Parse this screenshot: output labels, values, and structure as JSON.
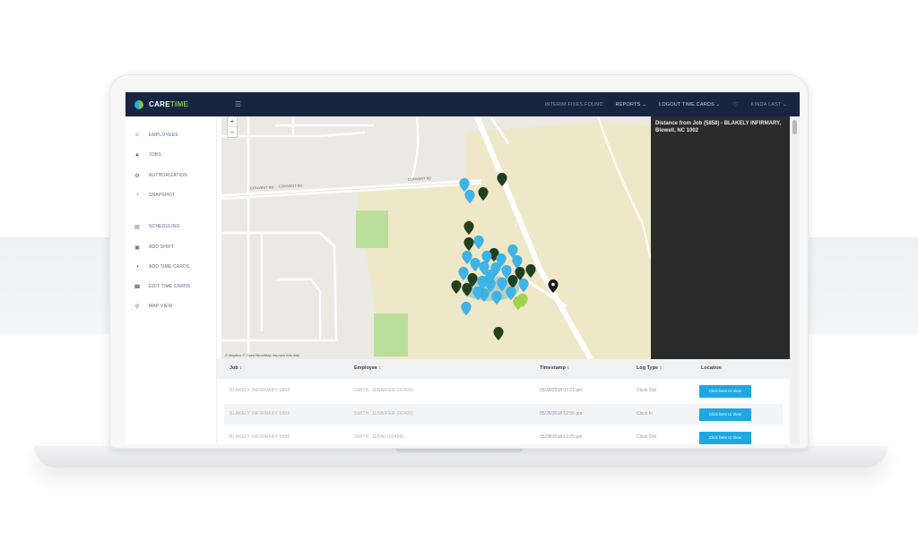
{
  "app": {
    "brand_main": "CARE",
    "brand_accent": "TIME",
    "brand_colors": {
      "navy": "#172540",
      "green": "#7fc241",
      "blue": "#1ea8e1"
    }
  },
  "topbar": {
    "menu_icon": "menu-icon",
    "links": [
      "INTERIM FIXES FOUND",
      "REPORTS ⌄",
      "LOGOUT TIME CARDS ⌄"
    ],
    "favorites_icon": "heart-icon",
    "user_label": "KINDA LAST ⌄"
  },
  "sidebar": {
    "items": [
      {
        "label": "EMPLOYEES",
        "icon": "user-icon",
        "glyph": "☺"
      },
      {
        "label": "JOBS",
        "icon": "person-icon",
        "glyph": "▲"
      },
      {
        "label": "AUTHORIZATION",
        "icon": "gear-icon",
        "glyph": "⚙"
      },
      {
        "label": "SNAPSHOT",
        "icon": "clock-icon",
        "glyph": "◔"
      },
      {
        "label": "SCHEDULING",
        "icon": "calendar-icon",
        "glyph": "▤"
      },
      {
        "label": "ADD SHIFT",
        "icon": "calendar-plus-icon",
        "glyph": "▣"
      },
      {
        "label": "ADD TIME CARDS",
        "icon": "clock-add-icon",
        "glyph": "◑"
      },
      {
        "label": "EDIT TIME CARDS",
        "icon": "phone-icon",
        "glyph": "☎"
      },
      {
        "label": "MAP VIEW",
        "icon": "map-pin-icon",
        "glyph": "⚲"
      }
    ]
  },
  "map": {
    "zoom_in": "+",
    "zoom_out": "−",
    "street_labels": [
      "CONVENT RD",
      "CONVENT RD",
      "CONVENT RD"
    ],
    "attribution": "© Mapbox © OpenStreetMap  Improve this map",
    "pin_colors": {
      "blue": "#3bb4e8",
      "dark": "#20401f",
      "lime": "#a4d24c",
      "black": "#1a1a1a"
    }
  },
  "info_panel": {
    "title": "Distance from Job (5858) - BLAKELY INFIRMARY, Blowell, NC 1002"
  },
  "table": {
    "headers": [
      "Job ↕",
      "Employee ↕",
      "Timestamp ↕",
      "Log Type ↕",
      "Location"
    ],
    "rows": [
      {
        "job": "BLAKELY INFIRMARY 5858",
        "employee": "SMITH, JENNIFER (00499)",
        "timestamp": "05/28/2018 07:27 pm",
        "log_type": "Clock Out",
        "button": "Click here to View"
      },
      {
        "job": "BLAKELY INFIRMARY 5858",
        "employee": "SMITH, JENNIFER (00499)",
        "timestamp": "05/28/2018 12:56 pm",
        "log_type": "Clock In",
        "button": "Click here to View"
      },
      {
        "job": "BLAKELY INFIRMARY 5888",
        "employee": "SMITH, JENNI (00499)",
        "timestamp": "05/28/2018 12:25 pm",
        "log_type": "Clock Out",
        "button": "Click here to View"
      }
    ]
  }
}
